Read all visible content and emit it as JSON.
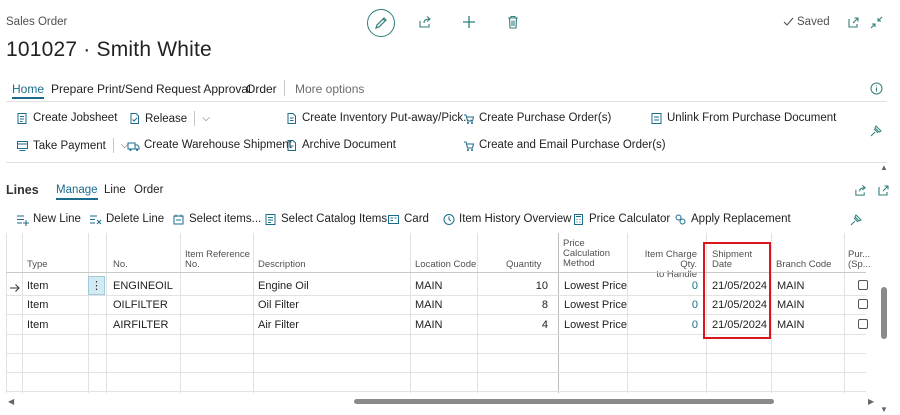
{
  "page": {
    "entity": "Sales Order",
    "title": "101027 · Smith White",
    "saved_label": "Saved"
  },
  "action_tabs": [
    "Home",
    "Prepare",
    "Print/Send",
    "Request Approval",
    "Order",
    "More options"
  ],
  "actions": {
    "create_jobsheet": "Create Jobsheet",
    "release": "Release",
    "create_inventory_putaway": "Create Inventory Put-away/Pick...",
    "create_purchase_orders": "Create Purchase Order(s)",
    "unlink_purchase_document": "Unlink From Purchase Document",
    "take_payment": "Take Payment",
    "create_warehouse_shipment": "Create Warehouse Shipment",
    "archive_document": "Archive Document",
    "create_email_purchase_orders": "Create and Email Purchase Order(s)"
  },
  "lines": {
    "caption": "Lines",
    "tabs": [
      "Manage",
      "Line",
      "Order"
    ],
    "actions": {
      "new_line": "New Line",
      "delete_line": "Delete Line",
      "select_items": "Select items...",
      "select_catalog_items": "Select Catalog Items",
      "card": "Card",
      "item_history_overview": "Item History Overview",
      "price_calculator": "Price Calculator",
      "apply_replacement": "Apply Replacement"
    },
    "columns": {
      "type": "Type",
      "no": "No.",
      "item_ref_1": "Item Reference",
      "item_ref_2": "No.",
      "description": "Description",
      "location_code": "Location Code",
      "quantity": "Quantity",
      "price_calc_1": "Price",
      "price_calc_2": "Calculation",
      "price_calc_3": "Method",
      "charge_1": "Item Charge Qty.",
      "charge_2": "to Handle",
      "ship_1": "Shipment",
      "ship_2": "Date",
      "branch_code": "Branch Code",
      "pur_1": "Pur...",
      "pur_2": "(Sp..."
    },
    "rows": [
      {
        "type": "Item",
        "no": "ENGINEOIL",
        "description": "Engine Oil",
        "location": "MAIN",
        "quantity": "10",
        "price_method": "Lowest Price",
        "charge_qty": "0",
        "shipment_date": "21/05/2024",
        "branch": "MAIN"
      },
      {
        "type": "Item",
        "no": "OILFILTER",
        "description": "Oil Filter",
        "location": "MAIN",
        "quantity": "8",
        "price_method": "Lowest Price",
        "charge_qty": "0",
        "shipment_date": "21/05/2024",
        "branch": "MAIN"
      },
      {
        "type": "Item",
        "no": "AIRFILTER",
        "description": "Air Filter",
        "location": "MAIN",
        "quantity": "4",
        "price_method": "Lowest Price",
        "charge_qty": "0",
        "shipment_date": "21/05/2024",
        "branch": "MAIN"
      }
    ]
  },
  "colors": {
    "accent": "#1b6b8c",
    "highlight_box": "#d9161c",
    "row_selector": "#d2eaf1"
  }
}
